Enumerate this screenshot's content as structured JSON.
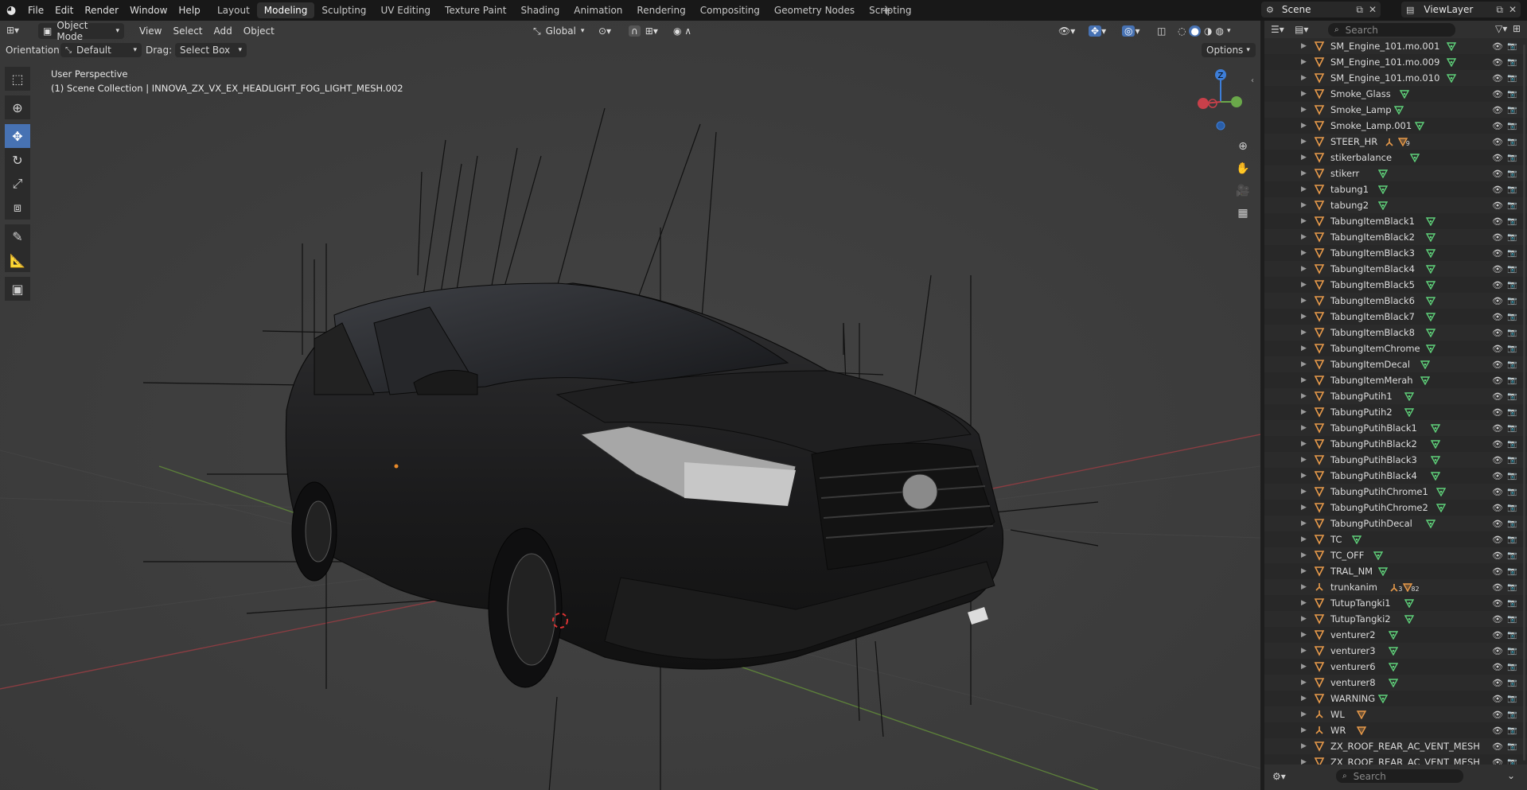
{
  "topbar": {
    "menu": [
      "File",
      "Edit",
      "Render",
      "Window",
      "Help"
    ],
    "workspaces": [
      "Layout",
      "Modeling",
      "Sculpting",
      "UV Editing",
      "Texture Paint",
      "Shading",
      "Animation",
      "Rendering",
      "Compositing",
      "Geometry Nodes",
      "Scripting"
    ],
    "active_workspace": "Modeling",
    "add_workspace": "+",
    "scene_name": "Scene",
    "view_layer": "ViewLayer"
  },
  "viewport_header": {
    "mode": "Object Mode",
    "menus": [
      "View",
      "Select",
      "Add",
      "Object"
    ],
    "transform_orientation": "Global"
  },
  "tool_header": {
    "orientation_label": "Orientation:",
    "orientation_value": "Default",
    "drag_label": "Drag:",
    "drag_value": "Select Box",
    "options": "Options"
  },
  "viewport": {
    "perspective": "User Perspective",
    "collection_info": "(1) Scene Collection | INNOVA_ZX_VX_EX_HEADLIGHT_FOG_LIGHT_MESH.002",
    "gizmo_labels": {
      "z": "Z"
    }
  },
  "tools": [
    "select-box",
    "cursor",
    "move",
    "rotate",
    "scale",
    "transform",
    "annotate",
    "measure",
    "add-cube"
  ],
  "active_tool": "move",
  "outliner": {
    "search_placeholder": "Search",
    "rows": [
      {
        "name": "SM_Engine_101.mo.001",
        "type": "mesh",
        "extra": "mesh-data"
      },
      {
        "name": "SM_Engine_101.mo.009",
        "type": "mesh",
        "extra": "mesh-data"
      },
      {
        "name": "SM_Engine_101.mo.010",
        "type": "mesh",
        "extra": "mesh-data"
      },
      {
        "name": "Smoke_Glass",
        "type": "mesh",
        "extra": "mesh-data"
      },
      {
        "name": "Smoke_Lamp",
        "type": "mesh",
        "extra": "mesh-data"
      },
      {
        "name": "Smoke_Lamp.001",
        "type": "mesh",
        "extra": "mesh-data"
      },
      {
        "name": "STEER_HR",
        "type": "mesh",
        "extra": "armature-children",
        "count": "9"
      },
      {
        "name": "stikerbalance",
        "type": "mesh",
        "extra": "mesh-data"
      },
      {
        "name": "stikerr",
        "type": "mesh",
        "extra": "mesh-data"
      },
      {
        "name": "tabung1",
        "type": "mesh",
        "extra": "mesh-data"
      },
      {
        "name": "tabung2",
        "type": "mesh",
        "extra": "mesh-data"
      },
      {
        "name": "TabungItemBlack1",
        "type": "mesh",
        "extra": "mesh-data"
      },
      {
        "name": "TabungItemBlack2",
        "type": "mesh",
        "extra": "mesh-data"
      },
      {
        "name": "TabungItemBlack3",
        "type": "mesh",
        "extra": "mesh-data"
      },
      {
        "name": "TabungItemBlack4",
        "type": "mesh",
        "extra": "mesh-data"
      },
      {
        "name": "TabungItemBlack5",
        "type": "mesh",
        "extra": "mesh-data"
      },
      {
        "name": "TabungItemBlack6",
        "type": "mesh",
        "extra": "mesh-data"
      },
      {
        "name": "TabungItemBlack7",
        "type": "mesh",
        "extra": "mesh-data"
      },
      {
        "name": "TabungItemBlack8",
        "type": "mesh",
        "extra": "mesh-data"
      },
      {
        "name": "TabungItemChrome",
        "type": "mesh",
        "extra": "mesh-data"
      },
      {
        "name": "TabungItemDecal",
        "type": "mesh",
        "extra": "mesh-data"
      },
      {
        "name": "TabungItemMerah",
        "type": "mesh",
        "extra": "mesh-data"
      },
      {
        "name": "TabungPutih1",
        "type": "mesh",
        "extra": "mesh-data"
      },
      {
        "name": "TabungPutih2",
        "type": "mesh",
        "extra": "mesh-data"
      },
      {
        "name": "TabungPutihBlack1",
        "type": "mesh",
        "extra": "mesh-data"
      },
      {
        "name": "TabungPutihBlack2",
        "type": "mesh",
        "extra": "mesh-data"
      },
      {
        "name": "TabungPutihBlack3",
        "type": "mesh",
        "extra": "mesh-data"
      },
      {
        "name": "TabungPutihBlack4",
        "type": "mesh",
        "extra": "mesh-data"
      },
      {
        "name": "TabungPutihChrome1",
        "type": "mesh",
        "extra": "mesh-data"
      },
      {
        "name": "TabungPutihChrome2",
        "type": "mesh",
        "extra": "mesh-data"
      },
      {
        "name": "TabungPutihDecal",
        "type": "mesh",
        "extra": "mesh-data"
      },
      {
        "name": "TC",
        "type": "mesh",
        "extra": "mesh-data"
      },
      {
        "name": "TC_OFF",
        "type": "mesh",
        "extra": "mesh-data"
      },
      {
        "name": "TRAL_NM",
        "type": "mesh",
        "extra": "mesh-data"
      },
      {
        "name": "trunkanim",
        "type": "empty",
        "extra": "armature-children",
        "count": "3",
        "count2": "82"
      },
      {
        "name": "TutupTangki1",
        "type": "mesh",
        "extra": "mesh-data"
      },
      {
        "name": "TutupTangki2",
        "type": "mesh",
        "extra": "mesh-data"
      },
      {
        "name": "venturer2",
        "type": "mesh",
        "extra": "mesh-data"
      },
      {
        "name": "venturer3",
        "type": "mesh",
        "extra": "mesh-data"
      },
      {
        "name": "venturer6",
        "type": "mesh",
        "extra": "mesh-data"
      },
      {
        "name": "venturer8",
        "type": "mesh",
        "extra": "mesh-data"
      },
      {
        "name": "WARNING",
        "type": "mesh",
        "extra": "mesh-data"
      },
      {
        "name": "WL",
        "type": "empty",
        "extra": "child-object"
      },
      {
        "name": "WR",
        "type": "empty",
        "extra": "child-object"
      },
      {
        "name": "ZX_ROOF_REAR_AC_VENT_MESH",
        "type": "mesh",
        "extra": "none"
      },
      {
        "name": "ZX_ROOF_REAR_AC_VENT_MESH",
        "type": "mesh",
        "extra": "none"
      }
    ]
  },
  "properties_header": {
    "search_placeholder": "Search"
  },
  "colors": {
    "accent": "#4772b3",
    "mesh_icon": "#e89a4a",
    "mesh_data_icon": "#5fd17a",
    "x_axis": "#c8404a",
    "y_axis": "#6aa84a",
    "z_axis": "#3d7ed8"
  }
}
